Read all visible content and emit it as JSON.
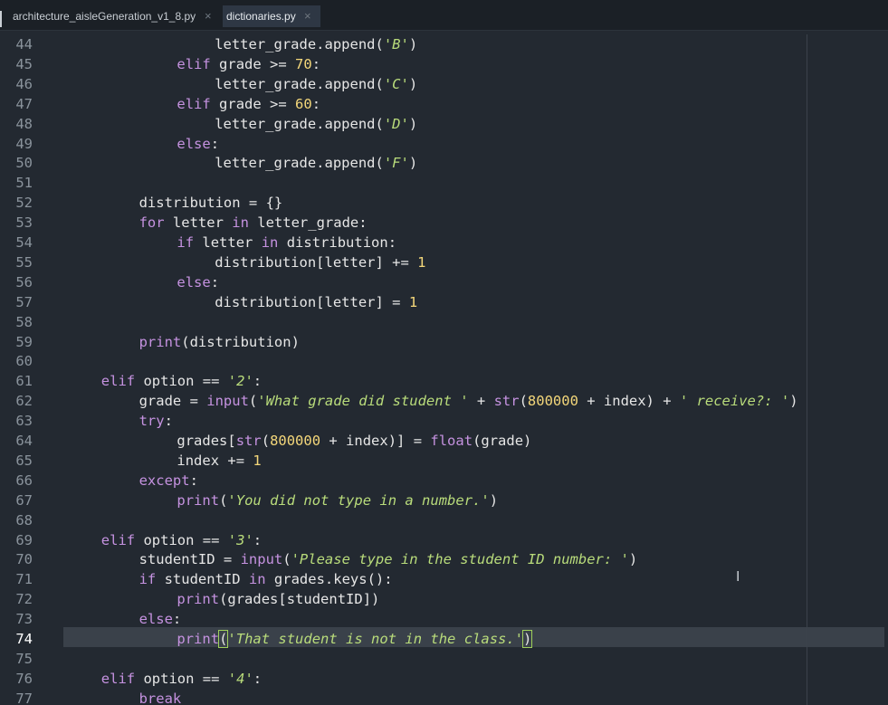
{
  "tabs": [
    {
      "label": "architecture_aisleGeneration_v1_8.py",
      "active": false,
      "close": "×"
    },
    {
      "label": "dictionaries.py",
      "active": true,
      "close": "×"
    }
  ],
  "editor": {
    "current_line": 74,
    "lines": [
      {
        "n": 44,
        "indent": 4,
        "tokens": [
          [
            "",
            "letter_grade.append("
          ],
          [
            "str",
            "'B'"
          ],
          [
            "",
            ")"
          ]
        ]
      },
      {
        "n": 45,
        "indent": 3,
        "tokens": [
          [
            "kw",
            "elif"
          ],
          [
            "",
            " grade >= "
          ],
          [
            "num",
            "70"
          ],
          [
            "",
            ":"
          ]
        ]
      },
      {
        "n": 46,
        "indent": 4,
        "tokens": [
          [
            "",
            "letter_grade.append("
          ],
          [
            "str",
            "'C'"
          ],
          [
            "",
            ")"
          ]
        ]
      },
      {
        "n": 47,
        "indent": 3,
        "tokens": [
          [
            "kw",
            "elif"
          ],
          [
            "",
            " grade >= "
          ],
          [
            "num",
            "60"
          ],
          [
            "",
            ":"
          ]
        ]
      },
      {
        "n": 48,
        "indent": 4,
        "tokens": [
          [
            "",
            "letter_grade.append("
          ],
          [
            "str",
            "'D'"
          ],
          [
            "",
            ")"
          ]
        ]
      },
      {
        "n": 49,
        "indent": 3,
        "tokens": [
          [
            "kw",
            "else"
          ],
          [
            "",
            ":"
          ]
        ]
      },
      {
        "n": 50,
        "indent": 4,
        "tokens": [
          [
            "",
            "letter_grade.append("
          ],
          [
            "str",
            "'F'"
          ],
          [
            "",
            ")"
          ]
        ]
      },
      {
        "n": 51,
        "indent": 0,
        "tokens": []
      },
      {
        "n": 52,
        "indent": 2,
        "tokens": [
          [
            "",
            "distribution = {}"
          ]
        ]
      },
      {
        "n": 53,
        "indent": 2,
        "tokens": [
          [
            "kw",
            "for"
          ],
          [
            "",
            " letter "
          ],
          [
            "kw",
            "in"
          ],
          [
            "",
            " letter_grade:"
          ]
        ]
      },
      {
        "n": 54,
        "indent": 3,
        "tokens": [
          [
            "kw",
            "if"
          ],
          [
            "",
            " letter "
          ],
          [
            "kw",
            "in"
          ],
          [
            "",
            " distribution:"
          ]
        ]
      },
      {
        "n": 55,
        "indent": 4,
        "tokens": [
          [
            "",
            "distribution[letter] += "
          ],
          [
            "num",
            "1"
          ]
        ]
      },
      {
        "n": 56,
        "indent": 3,
        "tokens": [
          [
            "kw",
            "else"
          ],
          [
            "",
            ":"
          ]
        ]
      },
      {
        "n": 57,
        "indent": 4,
        "tokens": [
          [
            "",
            "distribution[letter] = "
          ],
          [
            "num",
            "1"
          ]
        ]
      },
      {
        "n": 58,
        "indent": 0,
        "tokens": []
      },
      {
        "n": 59,
        "indent": 2,
        "tokens": [
          [
            "fn",
            "print"
          ],
          [
            "",
            "(distribution)"
          ]
        ]
      },
      {
        "n": 60,
        "indent": 0,
        "tokens": []
      },
      {
        "n": 61,
        "indent": 1,
        "tokens": [
          [
            "kw",
            "elif"
          ],
          [
            "",
            " option == "
          ],
          [
            "str",
            "'2'"
          ],
          [
            "",
            ":"
          ]
        ]
      },
      {
        "n": 62,
        "indent": 2,
        "tokens": [
          [
            "",
            "grade = "
          ],
          [
            "fn",
            "input"
          ],
          [
            "",
            "("
          ],
          [
            "str",
            "'What grade did student '"
          ],
          [
            "",
            " + "
          ],
          [
            "fn",
            "str"
          ],
          [
            "",
            "("
          ],
          [
            "num",
            "800000"
          ],
          [
            "",
            " + index) + "
          ],
          [
            "str",
            "' receive?: '"
          ],
          [
            "",
            ")"
          ]
        ]
      },
      {
        "n": 63,
        "indent": 2,
        "tokens": [
          [
            "kw",
            "try"
          ],
          [
            "",
            ":"
          ]
        ]
      },
      {
        "n": 64,
        "indent": 3,
        "tokens": [
          [
            "",
            "grades["
          ],
          [
            "fn",
            "str"
          ],
          [
            "",
            "("
          ],
          [
            "num",
            "800000"
          ],
          [
            "",
            " + index)] = "
          ],
          [
            "fn",
            "float"
          ],
          [
            "",
            "(grade)"
          ]
        ]
      },
      {
        "n": 65,
        "indent": 3,
        "tokens": [
          [
            "",
            "index += "
          ],
          [
            "num",
            "1"
          ]
        ]
      },
      {
        "n": 66,
        "indent": 2,
        "tokens": [
          [
            "kw",
            "except"
          ],
          [
            "",
            ":"
          ]
        ]
      },
      {
        "n": 67,
        "indent": 3,
        "tokens": [
          [
            "fn",
            "print"
          ],
          [
            "",
            "("
          ],
          [
            "str",
            "'You did not type in a number.'"
          ],
          [
            "",
            ")"
          ]
        ]
      },
      {
        "n": 68,
        "indent": 0,
        "tokens": []
      },
      {
        "n": 69,
        "indent": 1,
        "tokens": [
          [
            "kw",
            "elif"
          ],
          [
            "",
            " option == "
          ],
          [
            "str",
            "'3'"
          ],
          [
            "",
            ":"
          ]
        ]
      },
      {
        "n": 70,
        "indent": 2,
        "tokens": [
          [
            "",
            "studentID = "
          ],
          [
            "fn",
            "input"
          ],
          [
            "",
            "("
          ],
          [
            "str",
            "'Please type in the student ID number: '"
          ],
          [
            "",
            ")"
          ]
        ]
      },
      {
        "n": 71,
        "indent": 2,
        "tokens": [
          [
            "kw",
            "if"
          ],
          [
            "",
            " studentID "
          ],
          [
            "kw",
            "in"
          ],
          [
            "",
            " grades.keys():"
          ]
        ]
      },
      {
        "n": 72,
        "indent": 3,
        "tokens": [
          [
            "fn",
            "print"
          ],
          [
            "",
            "(grades[studentID])"
          ]
        ]
      },
      {
        "n": 73,
        "indent": 2,
        "tokens": [
          [
            "kw",
            "else"
          ],
          [
            "",
            ":"
          ]
        ]
      },
      {
        "n": 74,
        "indent": 3,
        "tokens": [
          [
            "fn",
            "print"
          ],
          [
            "match",
            "("
          ],
          [
            "str",
            "'That student is not in the class.'"
          ],
          [
            "match",
            ")"
          ]
        ]
      },
      {
        "n": 75,
        "indent": 0,
        "tokens": []
      },
      {
        "n": 76,
        "indent": 1,
        "tokens": [
          [
            "kw",
            "elif"
          ],
          [
            "",
            " option == "
          ],
          [
            "str",
            "'4'"
          ],
          [
            "",
            ":"
          ]
        ]
      },
      {
        "n": 77,
        "indent": 2,
        "tokens": [
          [
            "kw",
            "break"
          ]
        ]
      }
    ]
  },
  "cursor_icon": "I",
  "colors": {
    "background": "#232931",
    "keyword": "#c592e0",
    "string": "#b9dc7b",
    "number": "#f4d77a",
    "text": "#e6e6e6",
    "line_number": "#8a939c",
    "current_line": "#3a414a"
  }
}
